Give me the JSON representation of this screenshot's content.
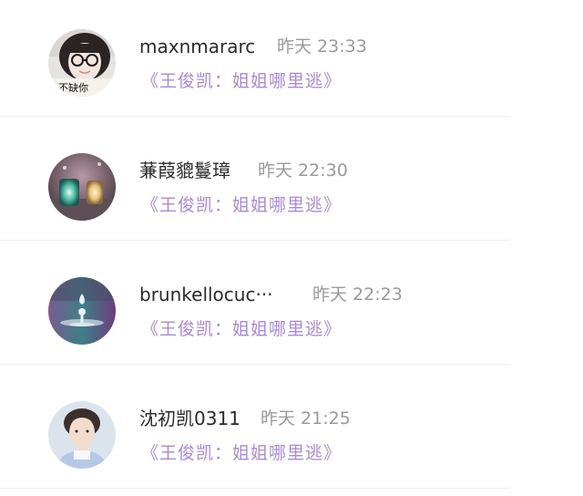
{
  "messages": [
    {
      "username": "maxnmararc",
      "time": "昨天 23:33",
      "message": "《王俊凯：姐姐哪里逃》",
      "avatar_text": "不缺你"
    },
    {
      "username": "蒹葭貔鬘璋",
      "time": "昨天 22:30",
      "message": "《王俊凯：姐姐哪里逃》"
    },
    {
      "username": "brunkellocuc···",
      "time": "昨天 22:23",
      "message": "《王俊凯：姐姐哪里逃》"
    },
    {
      "username": "沈初凯0311",
      "time": "昨天 21:25",
      "message": "《王俊凯：姐姐哪里逃》"
    }
  ],
  "colors": {
    "accent": "#a98ad6",
    "name": "#2a2a2a",
    "time": "#9a9a9a",
    "divider": "#efefef"
  }
}
